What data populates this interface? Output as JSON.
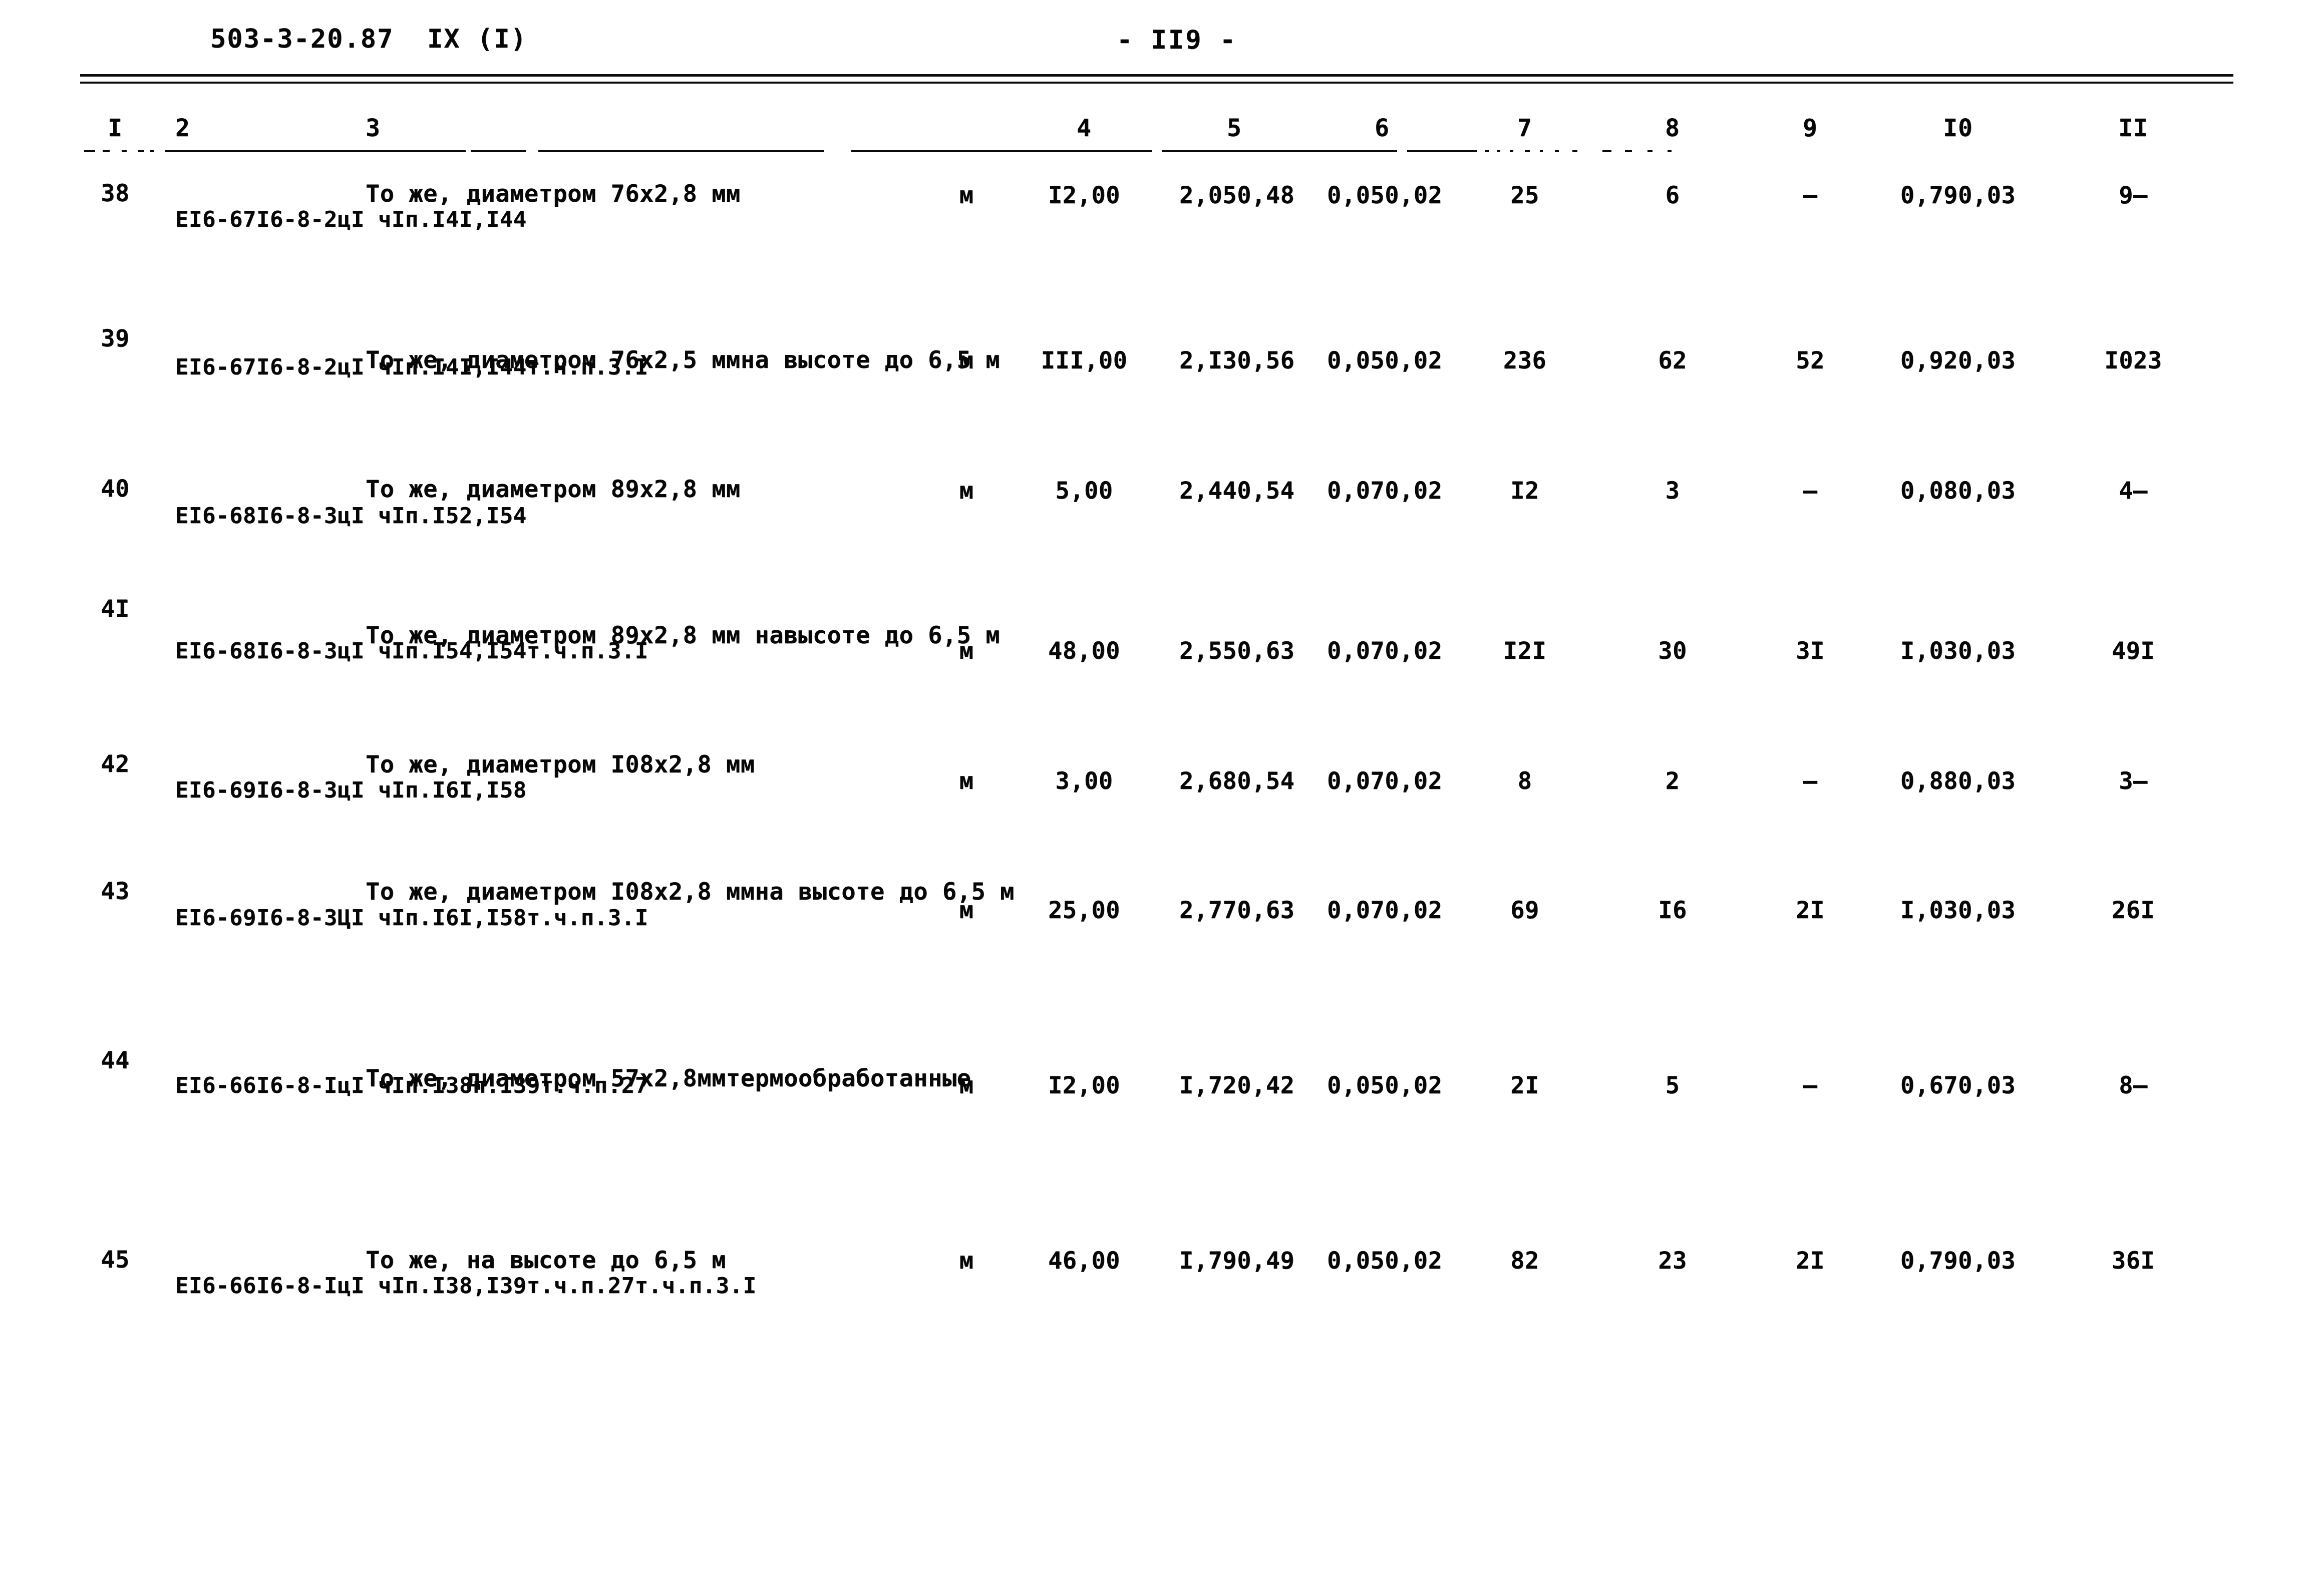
{
  "header": {
    "doc_code": "503-3-20.87  IX (I)",
    "page_label": "- II9 -"
  },
  "table": {
    "column_headers": [
      "I",
      "2",
      "3",
      "4",
      "5",
      "6",
      "7",
      "8",
      "9",
      "I0",
      "II"
    ],
    "rows": [
      {
        "num": "38",
        "code_lines": [
          "EI6-67",
          "I6-8-2",
          "цI чI",
          "п.I4I,I44"
        ],
        "desc_lines": [
          "То же, диаметром 76х2,8 мм"
        ],
        "unit": "м",
        "c4": "I2,00",
        "c5": [
          "2,05",
          "0,48"
        ],
        "c6": [
          "0,05",
          "0,02"
        ],
        "c7": "25",
        "c8": "6",
        "c9": [
          "–"
        ],
        "c10": [
          "0,79",
          "0,03"
        ],
        "c11": [
          "9",
          "–"
        ]
      },
      {
        "num": "39",
        "code_lines": [
          "EI6-67",
          "I6-8-2",
          "цI чI",
          "п.I4I,I44",
          "т.ч.",
          "п.3.I"
        ],
        "desc_lines": [
          "То же, диаметром 76х2,5 мм",
          "на высоте до 6,5 м"
        ],
        "unit": "м",
        "c4": "III,00",
        "c5": [
          "2,I3",
          "0,56"
        ],
        "c6": [
          "0,05",
          "0,02"
        ],
        "c7": "236",
        "c8": "62",
        "c9": [
          "5",
          "2"
        ],
        "c10": [
          "0,92",
          "0,03"
        ],
        "c11": [
          "I02",
          "3"
        ]
      },
      {
        "num": "40",
        "code_lines": [
          "EI6-68",
          "I6-8-3",
          "цI чI",
          "п.I52,I54"
        ],
        "desc_lines": [
          "То же, диаметром 89х2,8 мм"
        ],
        "unit": "м",
        "c4": "5,00",
        "c5": [
          "2,44",
          "0,54"
        ],
        "c6": [
          "0,07",
          "0,02"
        ],
        "c7": "I2",
        "c8": "3",
        "c9": [
          "–"
        ],
        "c10": [
          "0,08",
          "0,03"
        ],
        "c11": [
          "4",
          "–"
        ]
      },
      {
        "num": "4I",
        "code_lines": [
          "EI6-68",
          "I6-8-3",
          "цI чI",
          "п.I54,I54",
          "т.ч.",
          "п.3.I"
        ],
        "desc_lines": [
          "То же, диаметром 89х2,8 мм на",
          "высоте до 6,5 м"
        ],
        "unit": "м",
        "c4": "48,00",
        "c5": [
          "2,55",
          "0,63"
        ],
        "c6": [
          "0,07",
          "0,02"
        ],
        "c7": "I2I",
        "c8": "30",
        "c9": [
          "3",
          "I"
        ],
        "c10": [
          "I,03",
          "0,03"
        ],
        "c11": [
          "49",
          "I"
        ]
      },
      {
        "num": "42",
        "code_lines": [
          "EI6-69",
          "I6-8-3",
          "цI чI",
          "п.I6I,I58"
        ],
        "desc_lines": [
          "То же, диаметром I08х2,8 мм"
        ],
        "unit": "м",
        "c4": "3,00",
        "c5": [
          "2,68",
          "0,54"
        ],
        "c6": [
          "0,07",
          "0,02"
        ],
        "c7": "8",
        "c8": "2",
        "c9": [
          "–"
        ],
        "c10": [
          "0,88",
          "0,03"
        ],
        "c11": [
          "3",
          "–"
        ]
      },
      {
        "num": "43",
        "code_lines": [
          "EI6-69",
          "I6-8-3",
          "ЦI чI",
          "п.I6I,I58",
          "т.ч.",
          "п.3.I"
        ],
        "desc_lines": [
          "То же, диаметром I08х2,8 мм",
          "на высоте до 6,5 м"
        ],
        "unit": "м",
        "c4": "25,00",
        "c5": [
          "2,77",
          "0,63"
        ],
        "c6": [
          "0,07",
          "0,02"
        ],
        "c7": "69",
        "c8": "I6",
        "c9": [
          "2",
          "I"
        ],
        "c10": [
          "I,03",
          "0,03"
        ],
        "c11": [
          "26",
          "I"
        ]
      },
      {
        "num": "44",
        "code_lines": [
          "EI6-66",
          "I6-8-I",
          "цI чI",
          "п.I38",
          "п.I39",
          "т.ч.",
          "п.27"
        ],
        "desc_lines": [
          "То же, диаметром 57х2,8мм",
          "термообработанные"
        ],
        "unit": "м",
        "c4": "I2,00",
        "c5": [
          "I,72",
          "0,42"
        ],
        "c6": [
          "0,05",
          "0,02"
        ],
        "c7": "2I",
        "c8": "5",
        "c9": [
          "–"
        ],
        "c10": [
          "0,67",
          "0,03"
        ],
        "c11": [
          "8",
          "–"
        ]
      },
      {
        "num": "45",
        "code_lines": [
          "EI6-66",
          "I6-8-I",
          "цI чI",
          "п.I38,I39",
          "т.ч.",
          "п.27",
          "т.ч.",
          "п.3.I"
        ],
        "desc_lines": [
          "То же, на высоте до 6,5 м"
        ],
        "unit": "м",
        "c4": "46,00",
        "c5": [
          "I,79",
          "0,49"
        ],
        "c6": [
          "0,05",
          "0,02"
        ],
        "c7": "82",
        "c8": "23",
        "c9": [
          "2",
          "I"
        ],
        "c10": [
          "0,79",
          "0,03"
        ],
        "c11": [
          "36",
          "I"
        ]
      }
    ]
  }
}
